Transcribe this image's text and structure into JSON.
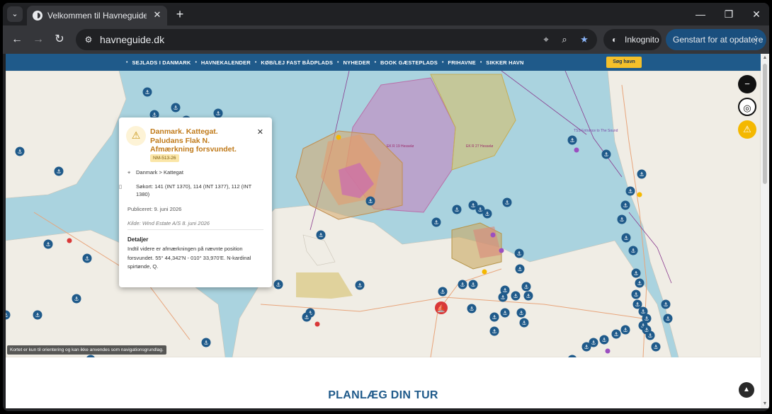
{
  "browser": {
    "tab_title": "Velkommen til Havneguide.dk |",
    "url": "havneguide.dk",
    "incognito_label": "Inkognito",
    "update_label": "Genstart for at opdatere"
  },
  "site_nav": {
    "items": [
      "SEJLADS I DANMARK",
      "HAVNEKALENDER",
      "KØB/LEJ FAST BÅDPLADS",
      "NYHEDER",
      "BOOK GÆSTEPLADS",
      "FRIHAVNE",
      "SIKKER HAVN"
    ],
    "search_label": "Søg havn"
  },
  "map": {
    "disclaimer": "Kortet er kun til orientering og kan ikke anvendes som navigationsgrundlag.",
    "labels": {
      "tss": "TSS Entrance to The Sound",
      "zone1": "EK R 19 Hesselø",
      "zone2": "EK R 27 Hesselø"
    }
  },
  "popup": {
    "title": "Danmark. Kattegat. Paludans Flak N. Afmærkning forsvundet.",
    "badge": "NM-513-26",
    "location": "Danmark > Kattegat",
    "charts": "Søkort: 141 (INT 1370), 114 (INT 1377), 112 (INT 1380)",
    "published": "Publiceret: 9. juni 2026",
    "source": "Kilde: Wind Estate A/S 8. juni 2026",
    "details_heading": "Detaljer",
    "details_text": "Indtil videre er afmærkningen på nævnte position forsvundet. 55° 44,342'N - 010° 33,970'E. N-kardinal spirtønde, Q."
  },
  "section_heading": "PLANLÆG DIN TUR",
  "colors": {
    "brand_blue": "#1f5a8a",
    "accent_yellow": "#f4c02a",
    "water": "#aad3df",
    "land": "#f0ede5",
    "marker": "#1f5a8a"
  }
}
